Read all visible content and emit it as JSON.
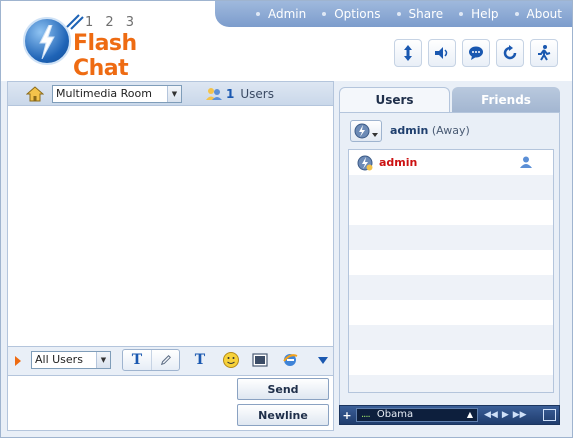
{
  "app": {
    "logo_digits": "1 2 3",
    "logo_text": "Flash Chat"
  },
  "topnav": [
    {
      "label": "Admin"
    },
    {
      "label": "Options"
    },
    {
      "label": "Share"
    },
    {
      "label": "Help"
    },
    {
      "label": "About"
    }
  ],
  "toolbar_icons": [
    "resize-icon",
    "sound-icon",
    "chat-bubble-icon",
    "refresh-icon",
    "exit-icon"
  ],
  "room": {
    "selected": "Multimedia Room",
    "users_count": "1",
    "users_label": "Users"
  },
  "composer": {
    "recipient": "All Users",
    "send_label": "Send",
    "newline_label": "Newline",
    "input_value": ""
  },
  "tabs": {
    "users": "Users",
    "friends": "Friends"
  },
  "me": {
    "name": "admin",
    "status": "(Away)"
  },
  "user_list": [
    {
      "name": "admin"
    }
  ],
  "media": {
    "eq": "....",
    "track": "Obama"
  },
  "colors": {
    "accent": "#ee6b12",
    "brand_blue": "#1a58b0",
    "nav_bg": "#8aa7d3",
    "user_red": "#cc1111"
  }
}
